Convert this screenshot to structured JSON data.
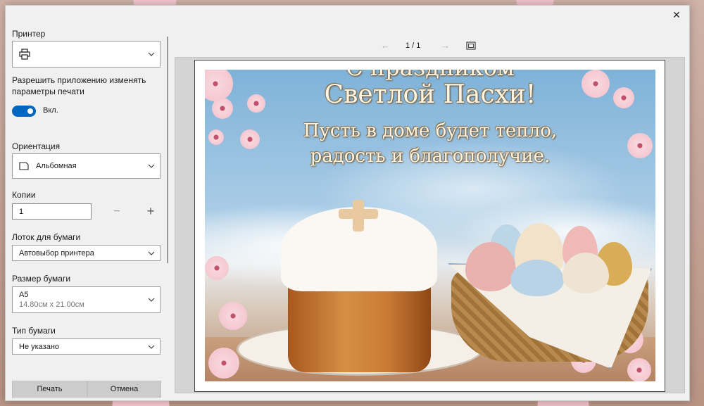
{
  "dialog": {
    "close_icon": "✕"
  },
  "left": {
    "printer_label": "Принтер",
    "printer_value": "",
    "allow_app_label_line1": "Разрешить приложению изменять",
    "allow_app_label_line2": "параметры печати",
    "toggle_state": "Вкл.",
    "orientation_label": "Ориентация",
    "orientation_value": "Альбомная",
    "copies_label": "Копии",
    "copies_value": "1",
    "minus": "−",
    "plus": "+",
    "tray_label": "Лоток для бумаги",
    "tray_value": "Автовыбор принтера",
    "paper_size_label": "Размер бумаги",
    "paper_size_value": "A5",
    "paper_size_dims": "14.80см x 21.00см",
    "paper_type_label": "Тип бумаги",
    "paper_type_value": "Не указано",
    "print_button": "Печать",
    "cancel_button": "Отмена"
  },
  "preview": {
    "page_indicator": "1 / 1",
    "prev_icon": "←",
    "next_icon": "→",
    "card_line1": "С праздником",
    "card_line2": "Светлой Пасхи!",
    "card_line3": "Пусть в доме будет тепло,",
    "card_line4": "радость и благополучие."
  },
  "colors": {
    "accent": "#0067c0",
    "dialog_bg": "#f0f0f0",
    "button_bg": "#cccccc"
  }
}
